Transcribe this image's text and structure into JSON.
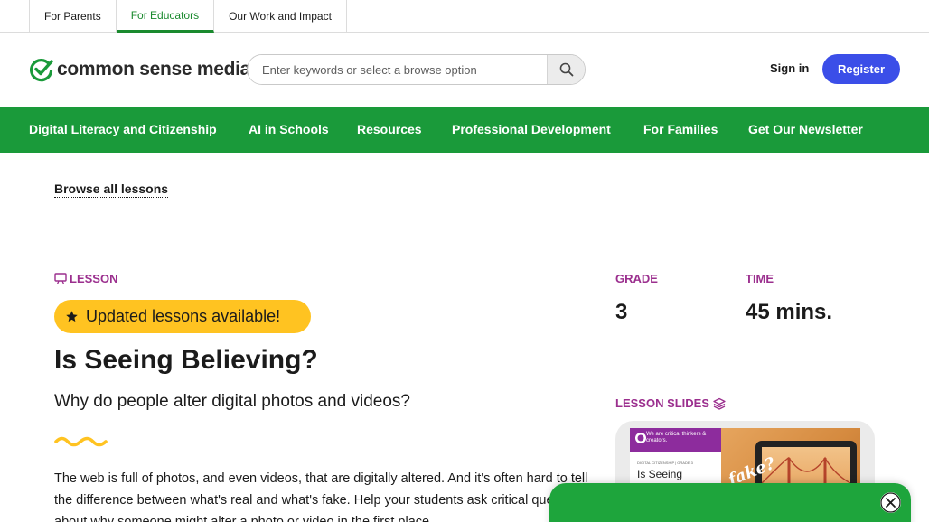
{
  "audience_tabs": [
    {
      "label": "For Parents"
    },
    {
      "label": "For Educators",
      "active": true
    },
    {
      "label": "Our Work and Impact"
    }
  ],
  "header": {
    "logo_text": "common sense media",
    "logo_icon": "checkmark-circle-icon",
    "search_placeholder": "Enter keywords or select a browse option",
    "search_icon": "search-icon",
    "sign_in": "Sign in",
    "register": "Register"
  },
  "main_nav": [
    {
      "label": "Digital Literacy and Citizenship"
    },
    {
      "label": "AI in Schools"
    },
    {
      "label": "Resources"
    },
    {
      "label": "Professional Development"
    },
    {
      "label": "For Families"
    },
    {
      "label": "Get Our Newsletter"
    }
  ],
  "breadcrumb": {
    "browse_all": "Browse all lessons"
  },
  "lesson": {
    "type_label": "LESSON",
    "type_icon": "presentation-icon",
    "updated_label": "Updated lessons available!",
    "updated_icon": "star-icon",
    "title": "Is Seeing Believing?",
    "subtitle": "Why do people alter digital photos and videos?",
    "description": "The web is full of photos, and even videos, that are digitally altered. And it's often hard to tell the difference between what's real and what's fake. Help your students ask critical questions about why someone might alter a photo or video in the first place."
  },
  "meta": {
    "grade_label": "GRADE",
    "grade_value": "3",
    "time_label": "TIME",
    "time_value": "45 mins."
  },
  "slides": {
    "label": "LESSON SLIDES",
    "icon": "layers-icon",
    "thumb_band_text": "We are critical thinkers & creators.",
    "thumb_meta": "DIGITAL CITIZENSHIP | GRADE 3",
    "thumb_title": "Is Seeing",
    "thumb_overlay": "fake?"
  },
  "popup": {
    "close_icon": "close-icon"
  },
  "colors": {
    "brand_green": "#1a9a3a",
    "accent_purple": "#9b2f8e",
    "register_blue": "#3b4ee8",
    "highlight_yellow": "#ffc321"
  }
}
